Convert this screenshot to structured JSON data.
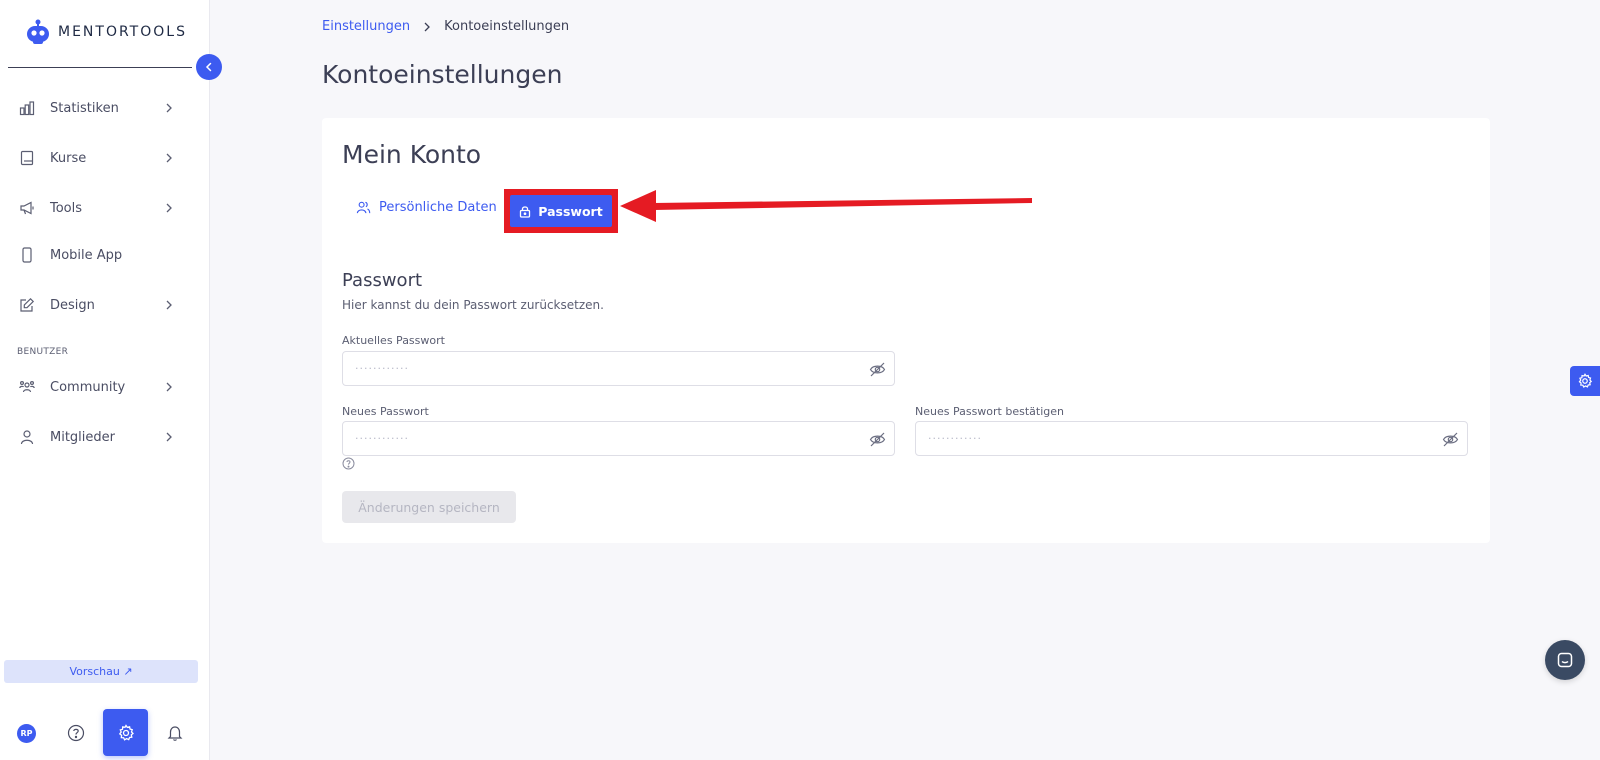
{
  "brand": {
    "name": "MENTORTOOLS"
  },
  "sidebar": {
    "items": [
      {
        "label": "Statistiken",
        "icon": "chart-icon"
      },
      {
        "label": "Kurse",
        "icon": "book-icon"
      },
      {
        "label": "Tools",
        "icon": "megaphone-icon"
      },
      {
        "label": "Mobile App",
        "icon": "phone-icon"
      },
      {
        "label": "Design",
        "icon": "edit-icon"
      }
    ],
    "section_label": "BENUTZER",
    "user_items": [
      {
        "label": "Community",
        "icon": "users-icon"
      },
      {
        "label": "Mitglieder",
        "icon": "user-icon"
      }
    ],
    "preview_label": "Vorschau ↗",
    "avatar_initials": "RP"
  },
  "breadcrumb": {
    "parent": "Einstellungen",
    "current": "Kontoeinstellungen"
  },
  "page_title": "Kontoeinstellungen",
  "card": {
    "title": "Mein Konto",
    "tabs": {
      "personal": "Persönliche Daten",
      "password": "Passwort"
    }
  },
  "password_section": {
    "title": "Passwort",
    "subtitle": "Hier kannst du dein Passwort zurücksetzen.",
    "current_label": "Aktuelles Passwort",
    "new_label": "Neues Passwort",
    "confirm_label": "Neues Passwort bestätigen",
    "placeholder": "············",
    "save_label": "Änderungen speichern"
  },
  "colors": {
    "accent": "#3d5bf0",
    "highlight": "#e51b23"
  }
}
